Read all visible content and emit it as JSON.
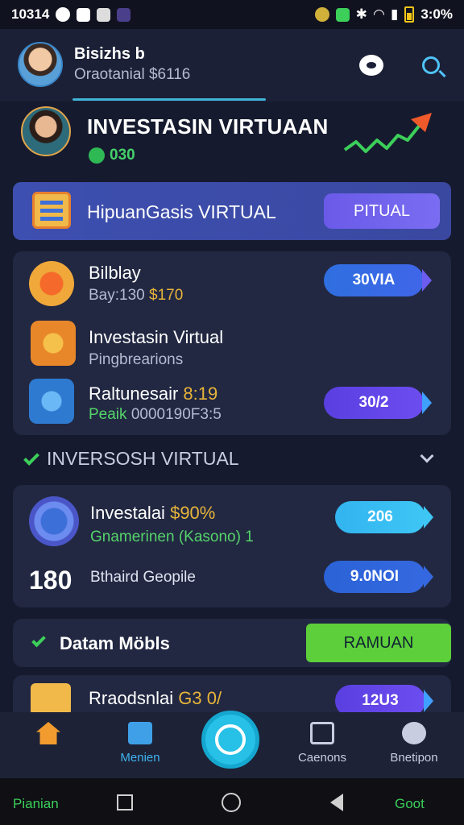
{
  "status_bar": {
    "time": "10314",
    "right_time": "3:0%"
  },
  "header": {
    "name": "Bisizhs b",
    "subtitle": "Oraotanial $6116"
  },
  "profile": {
    "title": "INVESTASIN VIRTUAAN",
    "coins": "030"
  },
  "banner": {
    "label": "HipuanGasis VIRTUAL",
    "button": "PITUAL"
  },
  "card1": {
    "row1": {
      "title": "Bilblay",
      "sub_prefix": "Bay:130",
      "sub_value": "$170",
      "pill": "30VIA"
    },
    "row2": {
      "title": "Investasin Virtual",
      "sub": "Pingbrearions"
    },
    "row3": {
      "title": "Raltunesair",
      "title_value": "8:19",
      "sub_prefix": "Peaik",
      "sub_value": "0000190F3:5",
      "pill": "30/2"
    }
  },
  "section": {
    "title": "INVERSOSH VIRTUAL"
  },
  "card2": {
    "row1": {
      "title": "Investalai",
      "title_value": "$90%",
      "sub": "Gnamerinen (Kasono) 1",
      "pill": "206"
    },
    "row2": {
      "badge": "180",
      "title": "Bthaird Geopile",
      "pill": "9.0NOI"
    }
  },
  "card3": {
    "label": "Datam Möbls",
    "button": "RAMUAN"
  },
  "card4": {
    "title": "Rraodsnlai",
    "title_value": "G3 0/",
    "pill": "12U3"
  },
  "bottom_nav": {
    "items": [
      {
        "label": ""
      },
      {
        "label": "Menien"
      },
      {
        "label": "Caenons"
      },
      {
        "label": "Bnetipon"
      }
    ]
  },
  "system_nav": {
    "left": "Pianian",
    "right": "Goot"
  },
  "colors": {
    "background": "#161a2e",
    "card": "#222842",
    "accent_cyan": "#27c0e6",
    "accent_green": "#5ccf3a",
    "accent_yellow": "#e8b53a"
  }
}
